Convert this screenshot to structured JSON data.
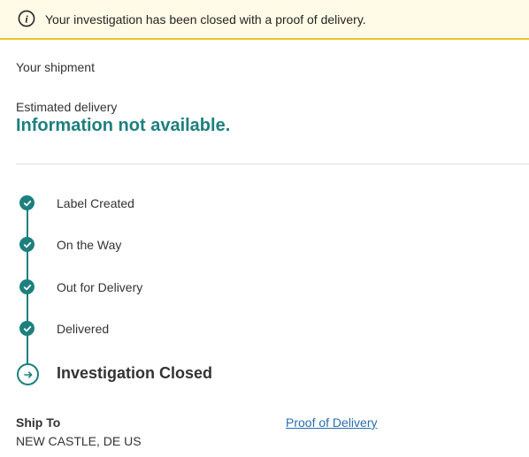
{
  "banner": {
    "icon": "info-icon",
    "text": "Your investigation has been closed with a proof of delivery."
  },
  "shipment": {
    "section_label": "Your shipment",
    "estimated_label": "Estimated delivery",
    "estimated_value": "Information not available."
  },
  "timeline": {
    "steps": [
      {
        "label": "Label Created",
        "status": "complete",
        "icon": "check-icon"
      },
      {
        "label": "On the Way",
        "status": "complete",
        "icon": "check-icon"
      },
      {
        "label": "Out for Delivery",
        "status": "complete",
        "icon": "check-icon"
      },
      {
        "label": "Delivered",
        "status": "complete",
        "icon": "check-icon"
      },
      {
        "label": "Investigation Closed",
        "status": "current",
        "icon": "arrow-right-icon"
      }
    ]
  },
  "ship_to": {
    "label": "Ship To",
    "value": "NEW CASTLE, DE US"
  },
  "links": {
    "proof_of_delivery": "Proof of Delivery"
  },
  "colors": {
    "accent": "#1e7f7f",
    "banner_bg": "#fffbe6",
    "banner_border": "#ebc427",
    "link": "#2a6cb3"
  }
}
